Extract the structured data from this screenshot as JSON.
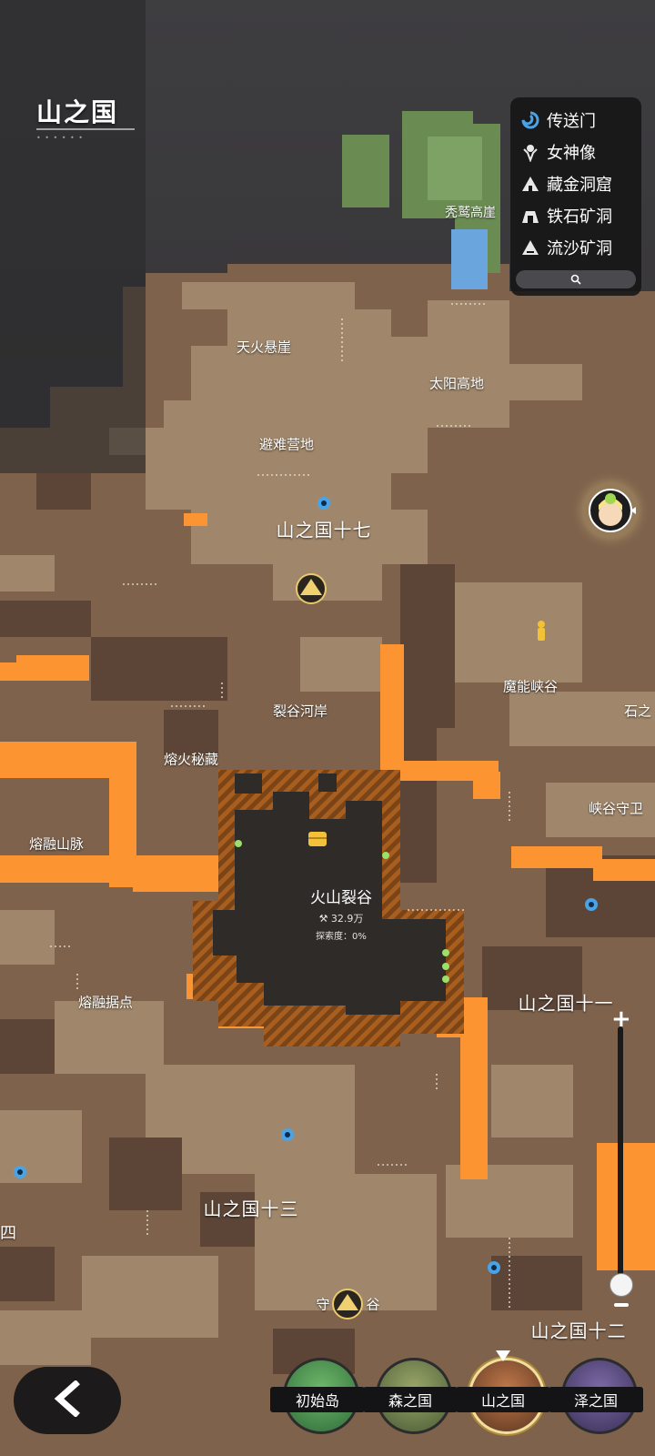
{
  "header": {
    "title": "山之国"
  },
  "legend": {
    "items": [
      {
        "icon": "portal-icon",
        "label": "传送门"
      },
      {
        "icon": "goddess-statue-icon",
        "label": "女神像"
      },
      {
        "icon": "treasure-cave-icon",
        "label": "藏金洞窟"
      },
      {
        "icon": "iron-mine-icon",
        "label": "铁石矿洞"
      },
      {
        "icon": "quicksand-mine-icon",
        "label": "流沙矿洞"
      }
    ],
    "search_icon": "search-icon"
  },
  "map_labels": {
    "xiuao_cliff": "秃鹫高崖",
    "tianhuo_cliff": "天火悬崖",
    "sun_highland": "太阳高地",
    "refuge_camp": "避难营地",
    "mountain_17": "山之国十七",
    "rift_riverbank": "裂谷河岸",
    "magic_canyon": "魔能峡谷",
    "stone_cut": "石之",
    "canyon_guard": "峡谷守卫",
    "molten_treasure": "熔火秘藏",
    "molten_range": "熔融山脉",
    "molten_base": "熔融据点",
    "mountain_11": "山之国十一",
    "mountain_13": "山之国十三",
    "guard_valley_left": "守",
    "guard_valley_right": "谷",
    "mountain_12": "山之国十二",
    "four_cut": "四"
  },
  "volcano": {
    "name": "火山裂谷",
    "stat": "32.9万",
    "exploration": "探索度：0%"
  },
  "regions": [
    {
      "label": "初始岛",
      "active": false
    },
    {
      "label": "森之国",
      "active": false
    },
    {
      "label": "山之国",
      "active": true
    },
    {
      "label": "泽之国",
      "active": false
    }
  ],
  "colors": {
    "terrain_light": "#a0876b",
    "terrain_mid": "#7e624c",
    "terrain_dark": "#5c4536",
    "lava": "#fb9431",
    "volcano_floor": "#2e2b29",
    "grass": "#6a8c52",
    "water": "#6aa5de",
    "portal": "#4aa3e6"
  }
}
